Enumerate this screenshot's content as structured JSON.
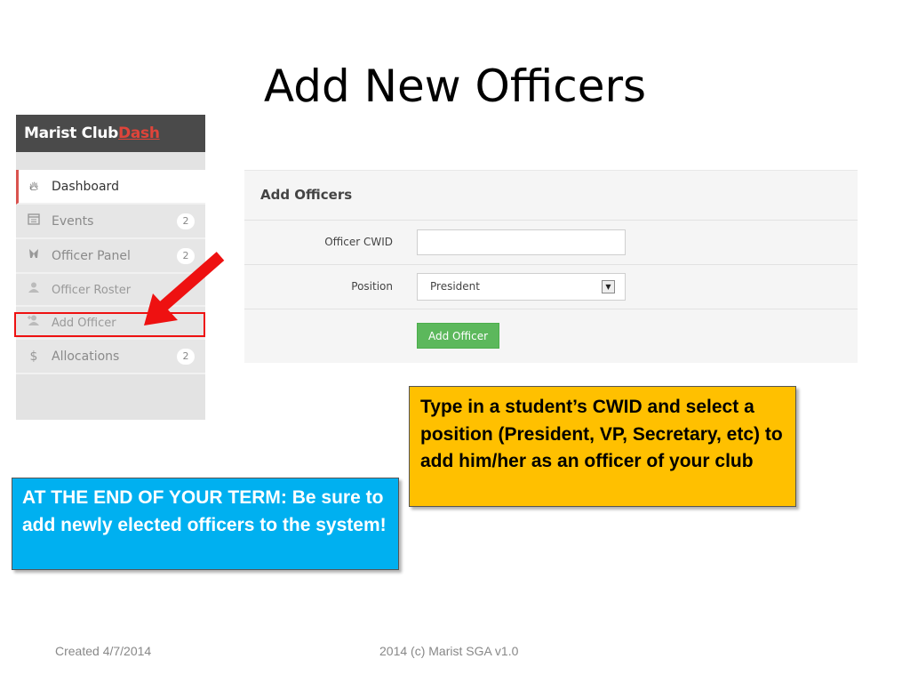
{
  "slide": {
    "title": "Add New Officers",
    "footer_left": "Created 4/7/2014",
    "footer_center": "2014 (c) Marist SGA v1.0"
  },
  "sidebar": {
    "brand_a": "Marist Club",
    "brand_b": "Dash",
    "items": [
      {
        "label": "Dashboard",
        "icon": "fire-icon",
        "active": true
      },
      {
        "label": "Events",
        "icon": "calendar-icon",
        "badge": "2"
      },
      {
        "label": "Officer Panel",
        "icon": "tools-icon",
        "badge": "2"
      },
      {
        "label": "Officer Roster",
        "icon": "user-icon"
      },
      {
        "label": "Add Officer",
        "icon": "add-user-icon",
        "highlighted": true
      },
      {
        "label": "Allocations",
        "icon": "dollar-icon",
        "badge": "2"
      }
    ]
  },
  "form": {
    "heading": "Add Officers",
    "cwid_label": "Officer CWID",
    "cwid_value": "",
    "position_label": "Position",
    "position_selected": "President",
    "submit_label": "Add Officer"
  },
  "callouts": {
    "yellow": "Type in a student’s CWID and select a position (President, VP, Secretary, etc) to add him/her as an officer of your club",
    "blue": "AT THE END OF YOUR TERM: Be sure to add newly elected officers to the system!"
  },
  "colors": {
    "highlight": "#ee1111",
    "yellow_callout": "#ffc000",
    "blue_callout": "#00b0f0",
    "button_green": "#5cb85c",
    "brand_accent": "#e0443a"
  }
}
